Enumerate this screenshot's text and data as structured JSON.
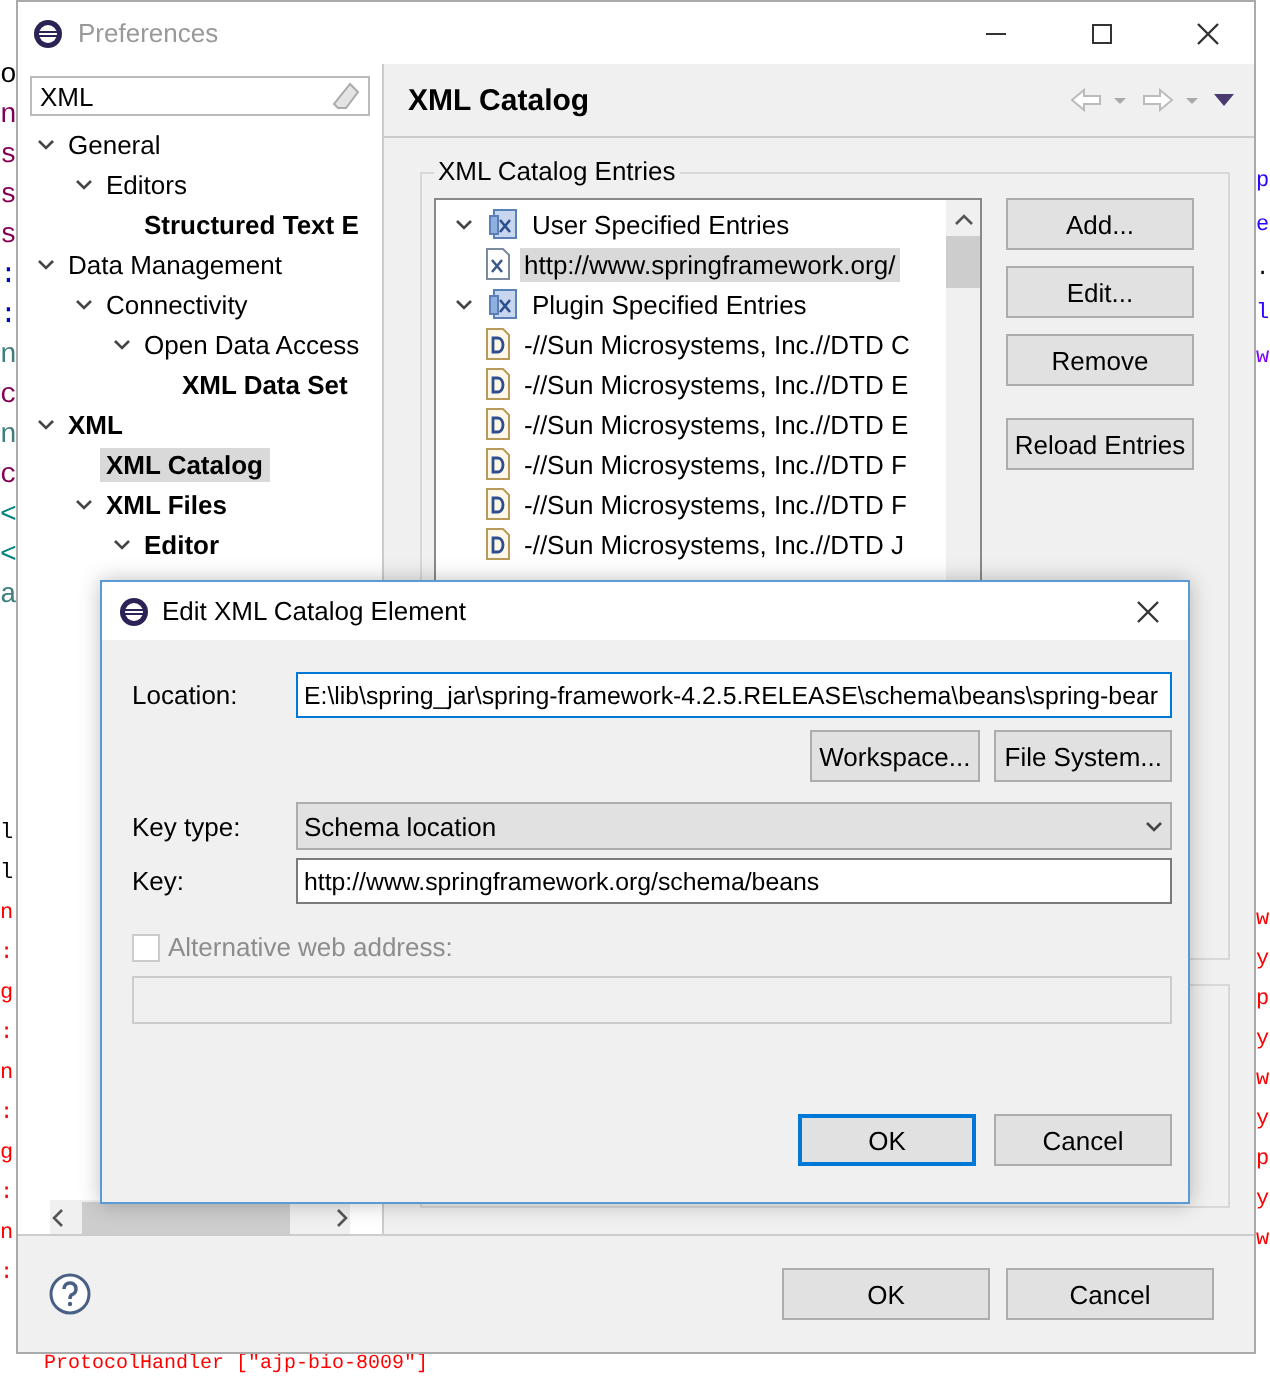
{
  "editor": {
    "left_top": [
      {
        "text": "o",
        "color": "#000000"
      },
      {
        "text": "n",
        "color": "#7f0055"
      },
      {
        "text": "s",
        "color": "#7f0055"
      },
      {
        "text": "s",
        "color": "#7f0055"
      },
      {
        "text": "s",
        "color": "#7f0055"
      },
      {
        "text": ":",
        "color": "#0000c0"
      },
      {
        "text": ":",
        "color": "#0000c0"
      },
      {
        "text": "n",
        "color": "#3f7f7f"
      },
      {
        "text": "c",
        "color": "#7f0055"
      },
      {
        "text": "n",
        "color": "#3f7f7f"
      },
      {
        "text": "c",
        "color": "#7f0055"
      },
      {
        "text": "<",
        "color": "#008080"
      },
      {
        "text": "<",
        "color": "#008080"
      },
      {
        "text": "a",
        "color": "#3f7f7f"
      }
    ],
    "left_bottom": [
      {
        "text": "l",
        "color": "#000000"
      },
      {
        "text": "l",
        "color": "#000000"
      },
      {
        "text": "n",
        "color": "#ff0000"
      },
      {
        "text": ":",
        "color": "#ff0000"
      },
      {
        "text": "g",
        "color": "#ff0000"
      },
      {
        "text": ":",
        "color": "#ff0000"
      },
      {
        "text": "n",
        "color": "#ff0000"
      },
      {
        "text": ":",
        "color": "#ff0000"
      },
      {
        "text": "g",
        "color": "#ff0000"
      },
      {
        "text": ":",
        "color": "#ff0000"
      },
      {
        "text": "n",
        "color": "#ff0000"
      },
      {
        "text": ":",
        "color": "#ff0000"
      }
    ],
    "right": [
      {
        "text": "p",
        "color": "#2a00ff"
      },
      {
        "text": "e",
        "color": "#2a00ff"
      },
      {
        "text": ".",
        "color": "#000000"
      },
      {
        "text": "l",
        "color": "#2a00ff"
      },
      {
        "text": "w",
        "color": "#7f00ff"
      }
    ],
    "right_bottom": [
      {
        "text": "w",
        "color": "#ff0000"
      },
      {
        "text": "y",
        "color": "#ff0000"
      },
      {
        "text": "p",
        "color": "#ff0000"
      },
      {
        "text": "y",
        "color": "#ff0000"
      },
      {
        "text": "w",
        "color": "#ff0000"
      },
      {
        "text": "y",
        "color": "#ff0000"
      },
      {
        "text": "p",
        "color": "#ff0000"
      },
      {
        "text": "y",
        "color": "#ff0000"
      },
      {
        "text": "w",
        "color": "#ff0000"
      }
    ],
    "bottom_line": {
      "text": "ProtocolHandler [\"ajp-bio-8009\"]",
      "color": "#ff0000"
    }
  },
  "preferences": {
    "title": "Preferences",
    "search": {
      "value": "XML"
    },
    "tree": [
      {
        "label": "General",
        "matched": false,
        "selected": false,
        "expanded": true,
        "children": [
          {
            "label": "Editors",
            "matched": false,
            "selected": false,
            "expanded": true,
            "children": [
              {
                "label": "Structured Text E",
                "matched": true,
                "selected": false
              }
            ]
          }
        ]
      },
      {
        "label": "Data Management",
        "matched": false,
        "selected": false,
        "expanded": true,
        "children": [
          {
            "label": "Connectivity",
            "matched": false,
            "selected": false,
            "expanded": true,
            "children": [
              {
                "label": "Open Data Access",
                "matched": false,
                "selected": false,
                "expanded": true,
                "children": [
                  {
                    "label": "XML Data Set",
                    "matched": true,
                    "selected": false
                  }
                ]
              }
            ]
          }
        ]
      },
      {
        "label": "XML",
        "matched": true,
        "selected": false,
        "expanded": true,
        "children": [
          {
            "label": "XML Catalog",
            "matched": true,
            "selected": true
          },
          {
            "label": "XML Files",
            "matched": true,
            "selected": false,
            "expanded": true,
            "children": [
              {
                "label": "Editor",
                "matched": true,
                "selected": false,
                "expanded": true
              }
            ]
          }
        ]
      }
    ],
    "page_title": "XML Catalog",
    "group_label": "XML Catalog Entries",
    "entries": [
      {
        "label": "User Specified Entries",
        "kind": "folder",
        "expanded": true,
        "selected": false,
        "children": [
          {
            "label": "http://www.springframework.org/",
            "kind": "schema",
            "selected": true
          }
        ]
      },
      {
        "label": "Plugin Specified Entries",
        "kind": "folder",
        "expanded": true,
        "selected": false,
        "children": [
          {
            "label": "-//Sun Microsystems, Inc.//DTD C",
            "kind": "dtd",
            "selected": false
          },
          {
            "label": "-//Sun Microsystems, Inc.//DTD E",
            "kind": "dtd",
            "selected": false
          },
          {
            "label": "-//Sun Microsystems, Inc.//DTD E",
            "kind": "dtd",
            "selected": false
          },
          {
            "label": "-//Sun Microsystems, Inc.//DTD F",
            "kind": "dtd",
            "selected": false
          },
          {
            "label": "-//Sun Microsystems, Inc.//DTD F",
            "kind": "dtd",
            "selected": false
          },
          {
            "label": "-//Sun Microsystems, Inc.//DTD J",
            "kind": "dtd",
            "selected": false
          }
        ]
      }
    ],
    "side_buttons": [
      "Add...",
      "Edit...",
      "Remove",
      "Reload Entries"
    ],
    "buttons": [
      "OK",
      "Cancel"
    ]
  },
  "dialog": {
    "title": "Edit XML Catalog Element",
    "location": {
      "label": "Location:",
      "value": "E:\\lib\\spring_jar\\spring-framework-4.2.5.RELEASE\\schema\\beans\\spring-bear"
    },
    "browse_buttons": [
      "Workspace...",
      "File System..."
    ],
    "key_type": {
      "label": "Key type:",
      "value": "Schema location"
    },
    "key": {
      "label": "Key:",
      "value": "http://www.springframework.org/schema/beans"
    },
    "alternative": {
      "label": "Alternative web address:",
      "checked": false,
      "disabled": true
    },
    "buttons": [
      {
        "label": "OK",
        "default": true
      },
      {
        "label": "Cancel",
        "default": false
      }
    ]
  }
}
